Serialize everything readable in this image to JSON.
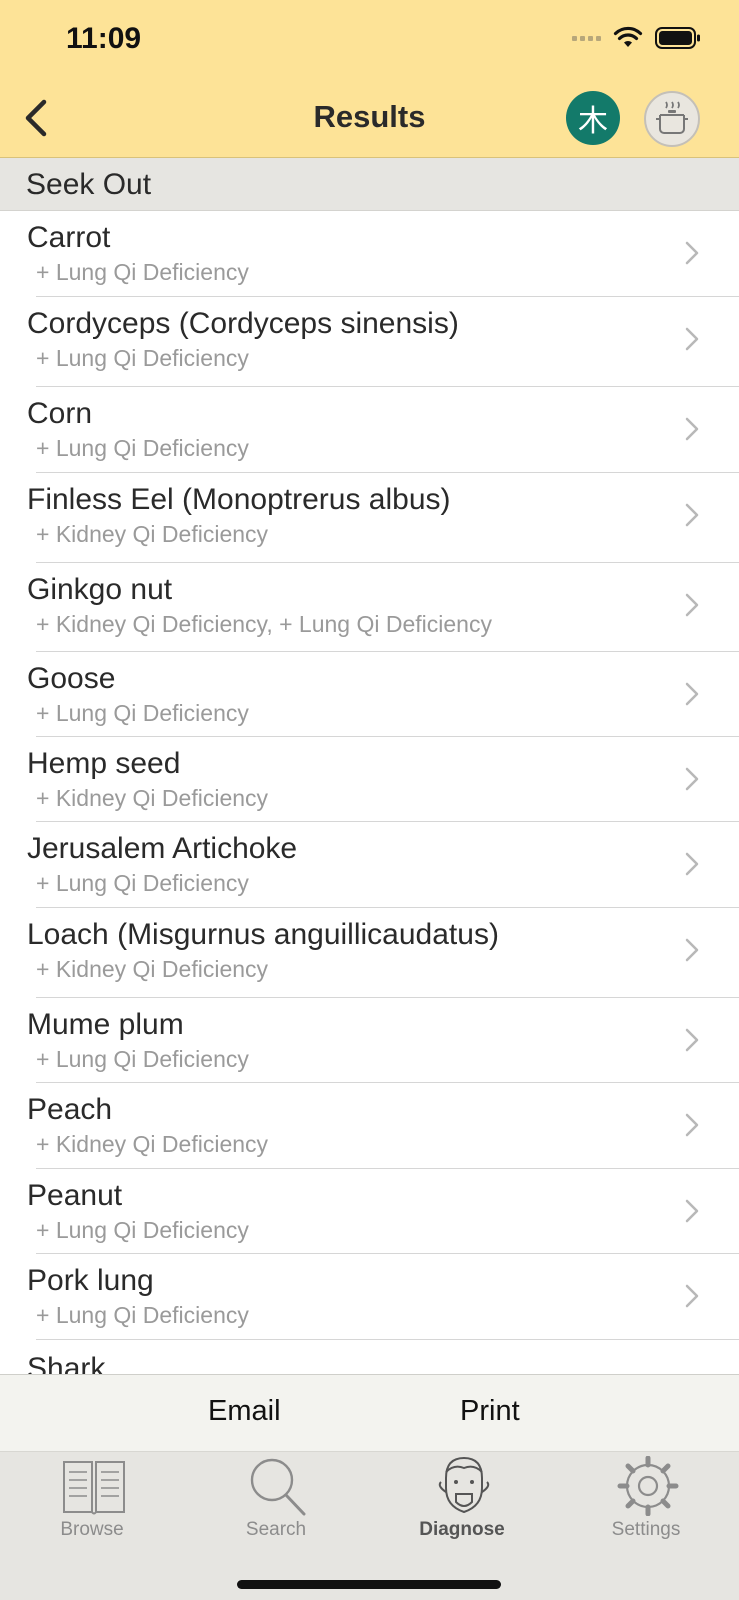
{
  "status_bar": {
    "time": "11:09"
  },
  "nav": {
    "title": "Results",
    "wood_glyph": "木"
  },
  "section": {
    "title": "Seek Out"
  },
  "items": [
    {
      "title": "Carrot",
      "subtitle": "+ Lung Qi Deficiency"
    },
    {
      "title": "Cordyceps (Cordyceps sinensis)",
      "subtitle": "+ Lung Qi Deficiency"
    },
    {
      "title": "Corn",
      "subtitle": "+ Lung Qi Deficiency"
    },
    {
      "title": "Finless Eel (Monoptrerus albus)",
      "subtitle": "+ Kidney Qi Deficiency"
    },
    {
      "title": "Ginkgo nut",
      "subtitle": "+ Kidney Qi Deficiency, + Lung Qi Deficiency"
    },
    {
      "title": "Goose",
      "subtitle": "+ Lung Qi Deficiency"
    },
    {
      "title": "Hemp seed",
      "subtitle": "+ Kidney Qi Deficiency"
    },
    {
      "title": "Jerusalem Artichoke",
      "subtitle": "+ Lung Qi Deficiency"
    },
    {
      "title": "Loach (Misgurnus anguillicaudatus)",
      "subtitle": "+ Kidney Qi Deficiency"
    },
    {
      "title": "Mume plum",
      "subtitle": "+ Lung Qi Deficiency"
    },
    {
      "title": "Peach",
      "subtitle": "+ Kidney Qi Deficiency"
    },
    {
      "title": "Peanut",
      "subtitle": "+ Lung Qi Deficiency"
    },
    {
      "title": "Pork lung",
      "subtitle": "+ Lung Qi Deficiency"
    },
    {
      "title": "Shark",
      "subtitle": ""
    }
  ],
  "actions": {
    "email": "Email",
    "print": "Print"
  },
  "tabs": [
    {
      "label": "Browse",
      "icon": "book-icon"
    },
    {
      "label": "Search",
      "icon": "search-icon"
    },
    {
      "label": "Diagnose",
      "icon": "tongue-face-icon",
      "active": true
    },
    {
      "label": "Settings",
      "icon": "gear-icon"
    }
  ],
  "colors": {
    "header_bg": "#fde397",
    "wood_button": "#137a6a",
    "section_bg": "#e6e5e1",
    "tab_bar_bg": "#e6e5e1"
  }
}
